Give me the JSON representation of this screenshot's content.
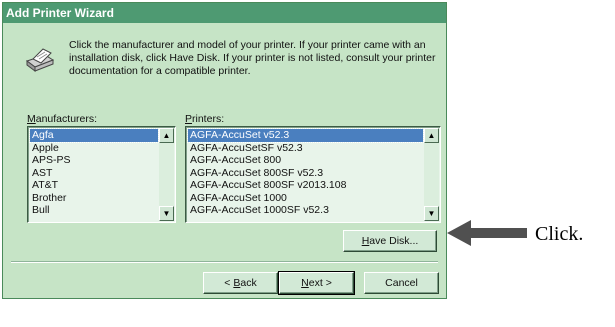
{
  "window": {
    "title": "Add Printer Wizard",
    "intro_text": "Click the manufacturer and model of your printer.  If your printer came with an installation disk, click Have Disk.  If your printer is not listed, consult your printer documentation for a compatible printer."
  },
  "manufacturers": {
    "label_mnemonic": "M",
    "label_rest": "anufacturers:",
    "items": [
      "Agfa",
      "Apple",
      "APS-PS",
      "AST",
      "AT&T",
      "Brother",
      "Bull"
    ],
    "selected": "Agfa"
  },
  "printers": {
    "label_mnemonic": "P",
    "label_rest": "rinters:",
    "items": [
      "AGFA-AccuSet v52.3",
      "AGFA-AccuSetSF v52.3",
      "AGFA-AccuSet 800",
      "AGFA-AccuSet 800SF v52.3",
      "AGFA-AccuSet 800SF v2013.108",
      "AGFA-AccuSet 1000",
      "AGFA-AccuSet 1000SF v52.3"
    ],
    "selected": "AGFA-AccuSet v52.3"
  },
  "buttons": {
    "have_disk_mnemonic": "H",
    "have_disk_rest": "ave Disk...",
    "back_prefix": "< ",
    "back_mnemonic": "B",
    "back_rest": "ack",
    "next_mnemonic": "N",
    "next_rest": "ext >",
    "cancel": "Cancel"
  },
  "annotation": {
    "callout": "Click.",
    "arrow_icon": "left-arrow-icon"
  },
  "colors": {
    "window_bg": "#c6e4c6",
    "titlebar_bg": "#4e9a72",
    "selection_bg": "#4a7fbf"
  }
}
